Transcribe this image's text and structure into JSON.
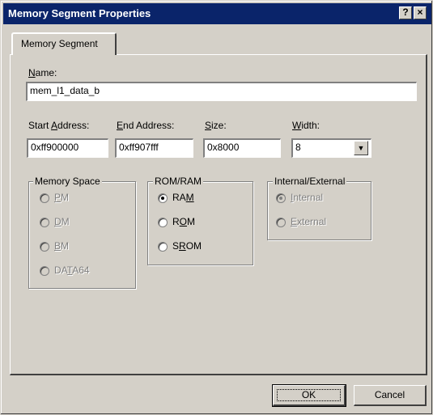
{
  "window": {
    "title": "Memory Segment Properties",
    "help_label": "?",
    "close_label": "×"
  },
  "tab": {
    "label": "Memory Segment"
  },
  "name": {
    "label_prefix": "",
    "label_accel": "N",
    "label_rest": "ame:",
    "value": "mem_l1_data_b"
  },
  "start_address": {
    "label_pre": "Start ",
    "label_accel": "A",
    "label_rest": "ddress:",
    "value": "0xff900000"
  },
  "end_address": {
    "label_accel": "E",
    "label_rest": "nd Address:",
    "value": "0xff907fff"
  },
  "size": {
    "label_accel": "S",
    "label_rest": "ize:",
    "value": "0x8000"
  },
  "width": {
    "label_accel": "W",
    "label_rest": "idth:",
    "value": "8"
  },
  "memory_space": {
    "title": "Memory Space",
    "options": [
      {
        "accel": "P",
        "rest": "M",
        "pre": "",
        "selected": false
      },
      {
        "accel": "D",
        "rest": "M",
        "pre": "",
        "selected": false
      },
      {
        "accel": "B",
        "rest": "M",
        "pre": "",
        "selected": false
      },
      {
        "pre": "DA",
        "accel": "T",
        "rest": "A64",
        "selected": false
      }
    ]
  },
  "rom_ram": {
    "title": "ROM/RAM",
    "options": [
      {
        "pre": "RA",
        "accel": "M",
        "rest": "",
        "selected": true
      },
      {
        "pre": "R",
        "accel": "O",
        "rest": "M",
        "selected": false
      },
      {
        "pre": "S",
        "accel": "R",
        "rest": "OM",
        "selected": false
      }
    ]
  },
  "internal_external": {
    "title": "Internal/External",
    "options": [
      {
        "pre": "",
        "accel": "I",
        "rest": "nternal",
        "selected": true
      },
      {
        "pre": "",
        "accel": "E",
        "rest": "xternal",
        "selected": false
      }
    ]
  },
  "buttons": {
    "ok": "OK",
    "cancel": "Cancel"
  }
}
